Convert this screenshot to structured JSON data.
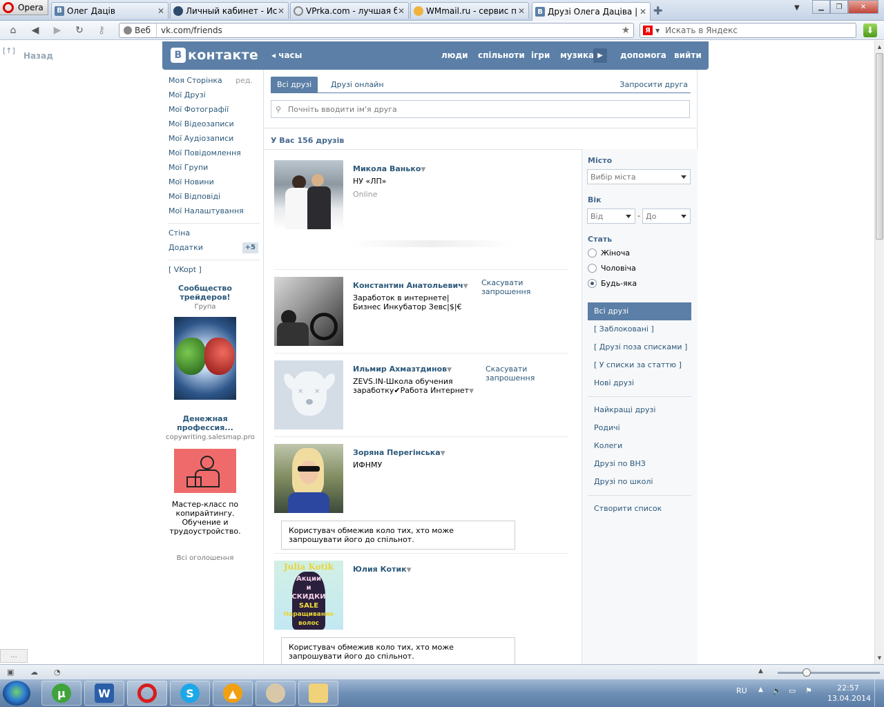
{
  "browser": {
    "menu_label": "Opera",
    "tabs": [
      {
        "title": "Олег Даців",
        "favicon": "vk-favicon"
      },
      {
        "title": "Личный кабинет - Ис...",
        "favicon": "globe-favicon"
      },
      {
        "title": "VPrka.com - лучшая б...",
        "favicon": "loading-favicon"
      },
      {
        "title": "WMmail.ru - сервис п...",
        "favicon": "wmmail-favicon"
      },
      {
        "title": "Друзі Олега Дацiва | 1...",
        "favicon": "vk-favicon"
      }
    ],
    "web_label": "Веб",
    "url": "vk.com/friends",
    "search_placeholder": "Искать в Яндекс",
    "search_logo": "Я"
  },
  "page": {
    "back_icon": "[↑]",
    "back_label": "Назад"
  },
  "vk": {
    "logo_letter": "В",
    "logo_text": "контакте",
    "hour_label": "часы",
    "nav": [
      "люди",
      "спільноти",
      "ігри",
      "музика",
      "допомога",
      "вийти"
    ]
  },
  "left_menu": {
    "items": [
      "Моя Сторінка",
      "Мої Друзі",
      "Мої Фотографії",
      "Мої Відеозаписи",
      "Мої Аудіозаписи",
      "Мої Повідомлення",
      "Мої Групи",
      "Мої Новини",
      "Мої Відповіді",
      "Мої Налаштування"
    ],
    "edit_label": "ред.",
    "wall": "Стіна",
    "apps": "Додатки",
    "apps_badge": "+5",
    "vkopt": "[ VKopt ]"
  },
  "ads": [
    {
      "title": "Сообщество трейдеров!",
      "subtitle": "Група",
      "text": ""
    },
    {
      "title": "Денежная профессия...",
      "subtitle": "copywriting.salesmap.pro",
      "text": "Мастер-класс по копирайтингу. Обучение и трудоустройство."
    }
  ],
  "all_ads": "Всі оголошення",
  "friends": {
    "tab_all": "Всі друзі",
    "tab_online": "Друзі онлайн",
    "invite": "Запросити друга",
    "search_placeholder": "Почніть вводити ім'я друга",
    "count_text": "У Вас 156 друзів",
    "list": [
      {
        "name": "Микола Ванько",
        "info": "НУ «ЛП»",
        "status": "Online",
        "action": "",
        "notice": ""
      },
      {
        "name": "Константин Анатольевич",
        "info": "Заработок в интернете|Бизнес Инкубатор Зевс|$|€",
        "status": "",
        "action": "Скасувати запрошення",
        "notice": ""
      },
      {
        "name": "Ильмир Ахмазтдинов",
        "info": "ZEVS.IN-Школа обучения заработку✔Работа Интернет",
        "status": "",
        "action": "Скасувати запрошення",
        "notice": ""
      },
      {
        "name": "Зоряна Перегінська",
        "info": "ИФНМУ",
        "status": "",
        "action": "",
        "notice": "Користувач обмежив коло тих, хто може запрошувати його до спільнот."
      },
      {
        "name": "Юлия Котик",
        "info": "",
        "status": "",
        "action": "",
        "notice": "Користувач обмежив коло тих, хто може запрошувати його до спільнот."
      }
    ],
    "dropdown_glyph": "▼"
  },
  "avatar_texts": {
    "julia_title": "Julia Kotik",
    "julia_lines": [
      "Акции",
      "и",
      "СКИДКИ",
      "SALE",
      "Наращивание",
      "волос"
    ]
  },
  "filter": {
    "city_label": "Місто",
    "city_value": "Вибір міста",
    "age_label": "Вік",
    "age_from": "Від",
    "age_to": "До",
    "age_dash": "-",
    "sex_label": "Стать",
    "sex_options": [
      "Жіноча",
      "Чоловіча",
      "Будь-яка"
    ],
    "sex_selected": "Будь-яка",
    "lists_a": [
      "Всі друзі",
      "[ Заблоковані ]",
      "[ Друзі поза списками ]",
      "[ У списки за статтю ]",
      "Нові друзі"
    ],
    "lists_b": [
      "Найкращі друзі",
      "Родичі",
      "Колеги",
      "Друзі по ВНЗ",
      "Друзі по школі"
    ],
    "create_list": "Створити список"
  },
  "statusbar": {
    "dots": "..."
  },
  "taskbar": {
    "lang": "RU",
    "time": "22:57",
    "date": "13.04.2014"
  },
  "colors": {
    "vk_blue": "#5b7fa6",
    "link": "#2b587a"
  }
}
